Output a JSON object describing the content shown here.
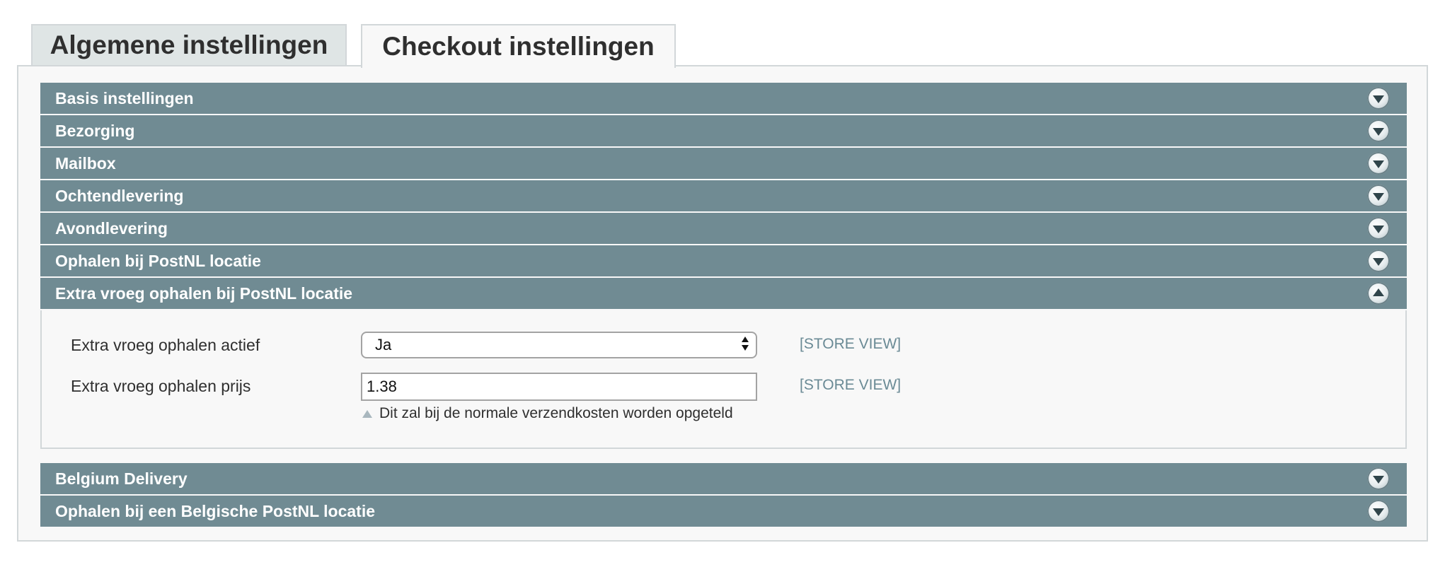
{
  "tabs": [
    {
      "label": "Algemene instellingen",
      "active": false
    },
    {
      "label": "Checkout instellingen",
      "active": true
    }
  ],
  "sections": [
    {
      "label": "Basis instellingen",
      "expanded": false
    },
    {
      "label": "Bezorging",
      "expanded": false
    },
    {
      "label": "Mailbox",
      "expanded": false
    },
    {
      "label": "Ochtendlevering",
      "expanded": false
    },
    {
      "label": "Avondlevering",
      "expanded": false
    },
    {
      "label": "Ophalen bij PostNL locatie",
      "expanded": false
    },
    {
      "label": "Extra vroeg ophalen bij PostNL locatie",
      "expanded": true
    },
    {
      "label": "Belgium Delivery",
      "expanded": false
    },
    {
      "label": "Ophalen bij een Belgische PostNL locatie",
      "expanded": false
    }
  ],
  "fields": {
    "active": {
      "label": "Extra vroeg ophalen actief",
      "value": "Ja",
      "scope": "[STORE VIEW]"
    },
    "price": {
      "label": "Extra vroeg ophalen prijs",
      "value": "1.38",
      "scope": "[STORE VIEW]",
      "hint": "Dit zal bij de normale verzendkosten worden opgeteld"
    }
  },
  "icons": {
    "collapsed_toggle": "chevron-down-icon",
    "expanded_toggle": "chevron-up-icon",
    "hint": "triangle-up-icon"
  },
  "colors": {
    "section_header": "#708b93",
    "scope_text": "#6a8a95"
  }
}
